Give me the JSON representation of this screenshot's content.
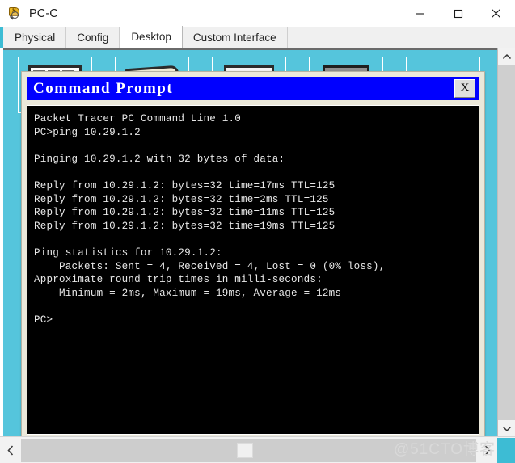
{
  "window": {
    "title": "PC-C",
    "icon": "packet-tracer-icon",
    "controls": {
      "minimize": "—",
      "maximize": "□",
      "close": "✕"
    }
  },
  "tabs": [
    {
      "label": "Physical",
      "active": false
    },
    {
      "label": "Config",
      "active": false
    },
    {
      "label": "Desktop",
      "active": true
    },
    {
      "label": "Custom Interface",
      "active": false
    }
  ],
  "desktop": {
    "background_color": "#55c5dc",
    "icons": [
      {
        "name": "desktop-icon-1",
        "glyph": "windows-panes-icon"
      },
      {
        "name": "desktop-icon-2",
        "glyph": "folder-icon"
      },
      {
        "name": "desktop-icon-3",
        "glyph": "document-icon"
      },
      {
        "name": "desktop-icon-4",
        "glyph": "monitor-icon"
      },
      {
        "name": "desktop-icon-5",
        "glyph": "cloud-icon"
      }
    ]
  },
  "command_prompt": {
    "title": "Command Prompt",
    "close_label": "X",
    "title_bg": "#0000FF",
    "terminal_bg": "#000000",
    "terminal_fg": "#E8E8E8",
    "lines": [
      "Packet Tracer PC Command Line 1.0",
      "PC>ping 10.29.1.2",
      "",
      "Pinging 10.29.1.2 with 32 bytes of data:",
      "",
      "Reply from 10.29.1.2: bytes=32 time=17ms TTL=125",
      "Reply from 10.29.1.2: bytes=32 time=2ms TTL=125",
      "Reply from 10.29.1.2: bytes=32 time=11ms TTL=125",
      "Reply from 10.29.1.2: bytes=32 time=19ms TTL=125",
      "",
      "Ping statistics for 10.29.1.2:",
      "    Packets: Sent = 4, Received = 4, Lost = 0 (0% loss),",
      "Approximate round trip times in milli-seconds:",
      "    Minimum = 2ms, Maximum = 19ms, Average = 12ms",
      ""
    ],
    "prompt": "PC>"
  },
  "scrollbars": {
    "vertical_up": "∧",
    "vertical_down": "∨",
    "horizontal_left": "‹",
    "horizontal_right": "›"
  },
  "watermark": "@51CTO博客"
}
